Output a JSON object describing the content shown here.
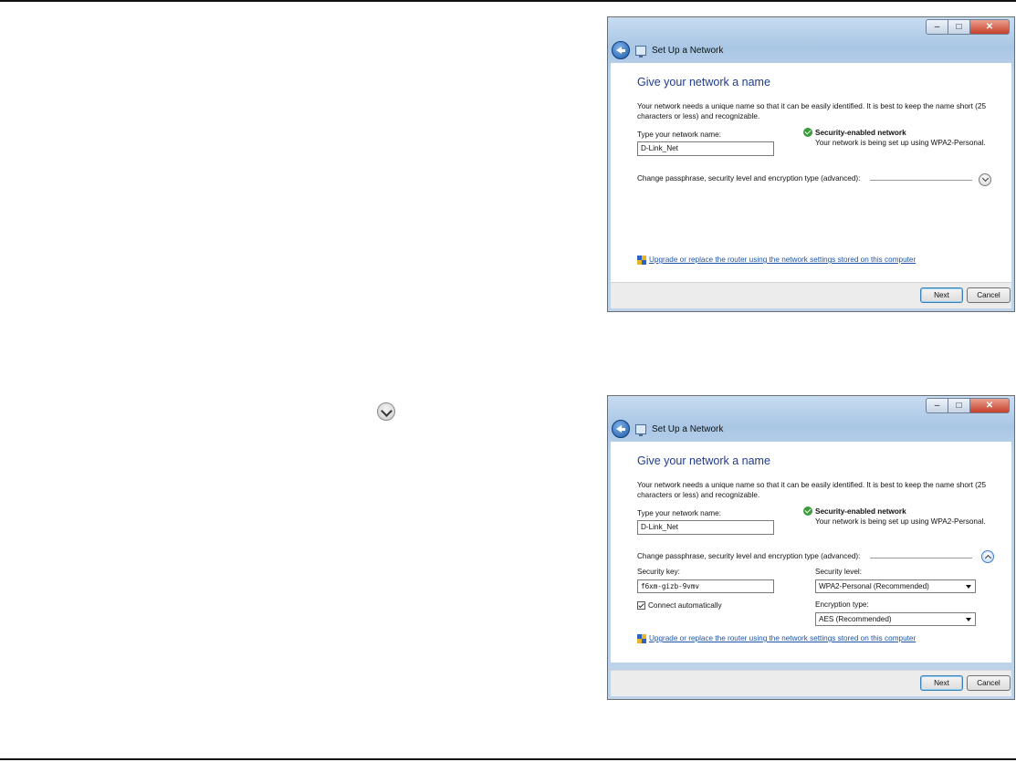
{
  "windows": [
    {
      "title": "Set Up a Network",
      "heading": "Give your network a name",
      "description": "Your network needs a unique name so that it can be easily identified. It is best to keep the name short (25 characters or less) and recognizable.",
      "name_label": "Type your network name:",
      "name_value": "D-Link_Net",
      "security_title": "Security-enabled network",
      "security_desc": "Your network is being set up using WPA2-Personal.",
      "advanced_label": "Change passphrase, security level and encryption type (advanced):",
      "advanced_expanded": false,
      "link": "Upgrade or replace the router using the network settings stored on this computer",
      "next_label": "Next",
      "cancel_label": "Cancel"
    },
    {
      "title": "Set Up a Network",
      "heading": "Give your network a name",
      "description": "Your network needs a unique name so that it can be easily identified. It is best to keep the name short (25 characters or less) and recognizable.",
      "name_label": "Type your network name:",
      "name_value": "D-Link_Net",
      "security_title": "Security-enabled network",
      "security_desc": "Your network is being set up using WPA2-Personal.",
      "advanced_label": "Change passphrase, security level and encryption type (advanced):",
      "advanced_expanded": true,
      "security_key_label": "Security key:",
      "security_key_value": "f6xm-gizb-9vmv",
      "connect_auto_label": "Connect automatically",
      "connect_auto_checked": true,
      "security_level_label": "Security level:",
      "security_level_value": "WPA2-Personal (Recommended)",
      "encryption_label": "Encryption type:",
      "encryption_value": "AES (Recommended)",
      "link": "Upgrade or replace the router using the network settings stored on this computer",
      "next_label": "Next",
      "cancel_label": "Cancel"
    }
  ],
  "icons": {
    "standalone": "chevron-down-icon"
  }
}
